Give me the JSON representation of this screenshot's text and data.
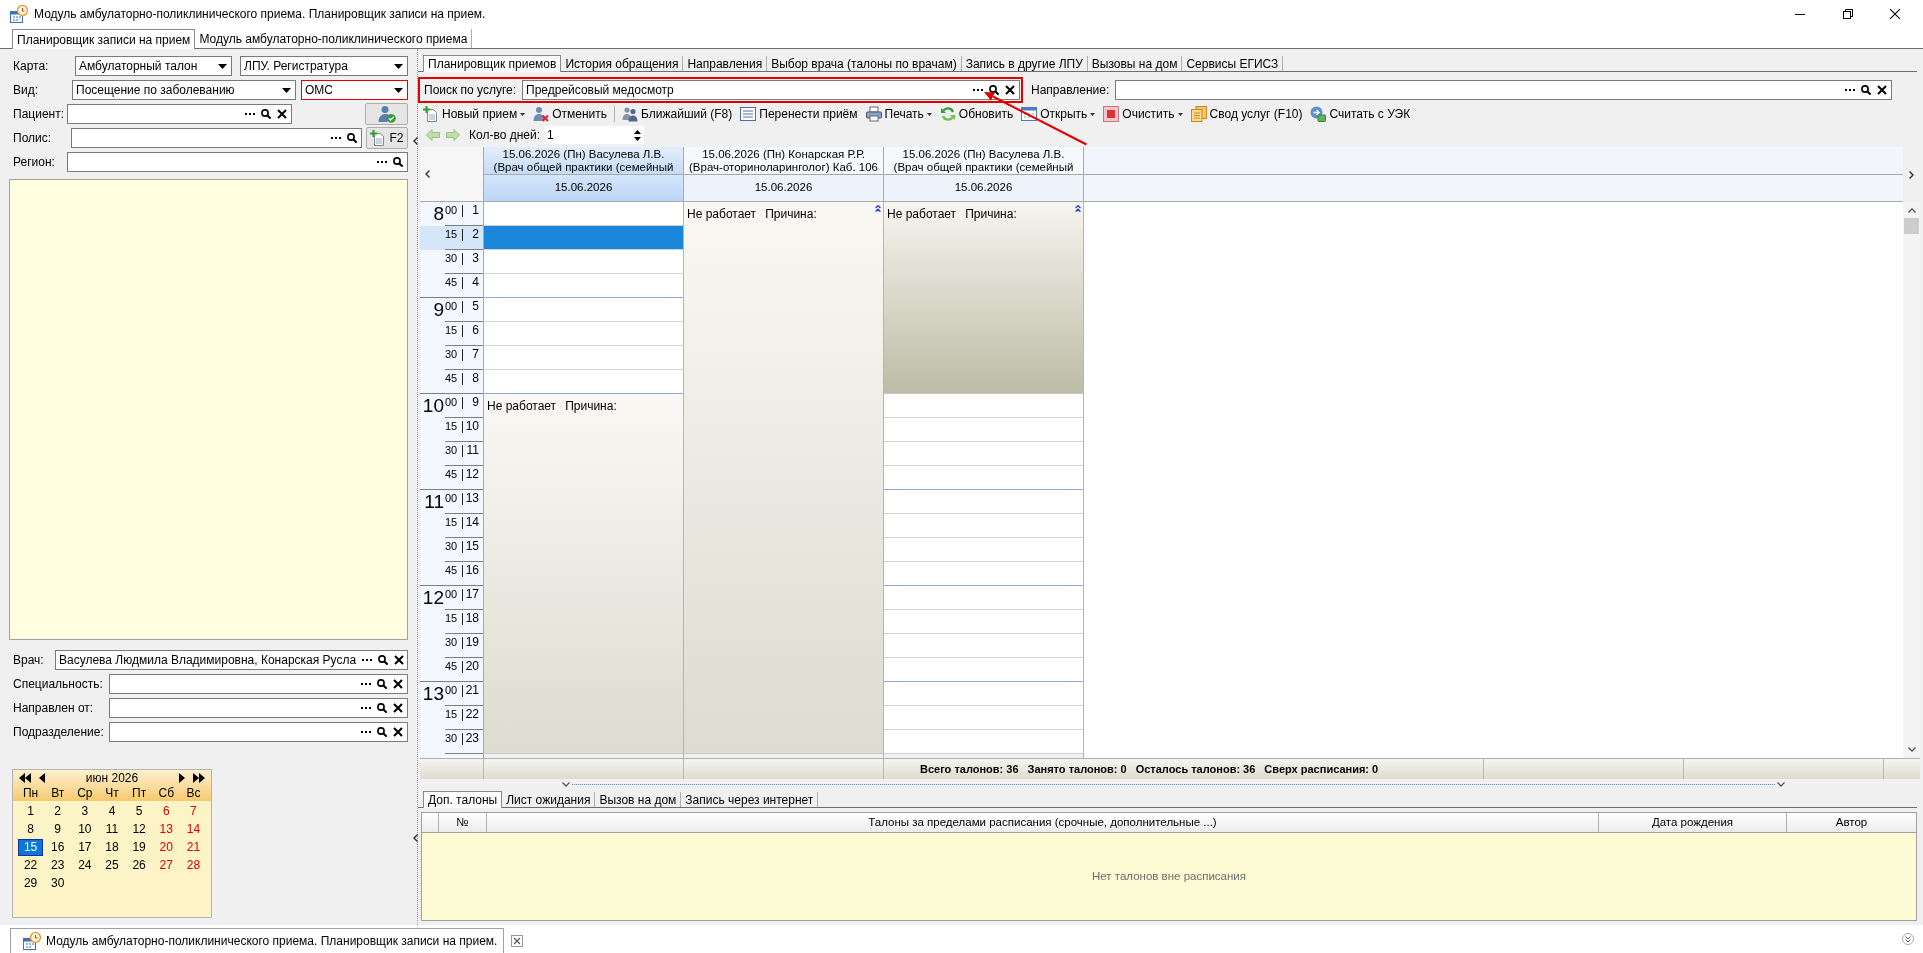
{
  "window": {
    "title": "Модуль амбулаторно-поликлинического приема. Планировщик записи на прием."
  },
  "main_tabs": [
    {
      "label": "Планировщик записи на прием",
      "selected": true
    },
    {
      "label": "Модуль амбулаторно-поликлинического приема",
      "selected": false
    }
  ],
  "left_panel": {
    "filters": [
      {
        "label": "Карта:",
        "controls": [
          {
            "kind": "dropdown",
            "value": "Амбулаторный талон"
          },
          {
            "kind": "dropdown",
            "value": "ЛПУ. Регистратура"
          }
        ]
      },
      {
        "label": "Вид:",
        "controls": [
          {
            "kind": "dropdown",
            "value": "Посещение по заболеванию"
          },
          {
            "kind": "dropdown",
            "value": "ОМС",
            "highlighted": true
          }
        ]
      },
      {
        "label": "Пациент:",
        "controls": [
          {
            "kind": "lookup",
            "actions": [
              {
                "kind": "browse"
              },
              {
                "kind": "search"
              },
              {
                "kind": "clear"
              }
            ]
          },
          {
            "kind": "patient_button"
          }
        ]
      },
      {
        "label": "Полис:",
        "controls": [
          {
            "kind": "lookup",
            "actions": [
              {
                "kind": "browse"
              },
              {
                "kind": "search"
              }
            ]
          },
          {
            "kind": "policy_button",
            "label": "F2"
          }
        ]
      },
      {
        "label": "Регион:",
        "controls": [
          {
            "kind": "lookup",
            "actions": [
              {
                "kind": "browse"
              },
              {
                "kind": "search"
              }
            ]
          }
        ]
      }
    ],
    "doctor_filters": [
      {
        "label": "Врач:",
        "value": "Васулева Людмила Владимировна, Конарская Русла",
        "actions": [
          {
            "kind": "browse"
          },
          {
            "kind": "search"
          },
          {
            "kind": "clear"
          }
        ]
      },
      {
        "label": "Специальность:",
        "actions": [
          {
            "kind": "browse"
          },
          {
            "kind": "search"
          },
          {
            "kind": "clear"
          }
        ]
      },
      {
        "label": "Направлен от:",
        "actions": [
          {
            "kind": "browse"
          },
          {
            "kind": "search"
          },
          {
            "kind": "clear"
          }
        ]
      },
      {
        "label": "Подразделение:",
        "actions": [
          {
            "kind": "browse"
          },
          {
            "kind": "search"
          },
          {
            "kind": "clear"
          }
        ]
      }
    ],
    "calendar": {
      "month": "июн 2026",
      "weekdays": [
        "Пн",
        "Вт",
        "Ср",
        "Чт",
        "Пт",
        "Сб",
        "Вс"
      ],
      "weeks": [
        [
          {
            "day": "1",
            "weekend": false,
            "selected": false
          },
          {
            "day": "2",
            "weekend": false,
            "selected": false
          },
          {
            "day": "3",
            "weekend": false,
            "selected": false
          },
          {
            "day": "4",
            "weekend": false,
            "selected": false
          },
          {
            "day": "5",
            "weekend": false,
            "selected": false
          },
          {
            "day": "6",
            "weekend": true,
            "selected": false
          },
          {
            "day": "7",
            "weekend": true,
            "selected": false
          }
        ],
        [
          {
            "day": "8",
            "weekend": false,
            "selected": false
          },
          {
            "day": "9",
            "weekend": false,
            "selected": false
          },
          {
            "day": "10",
            "weekend": false,
            "selected": false
          },
          {
            "day": "11",
            "weekend": false,
            "selected": false
          },
          {
            "day": "12",
            "weekend": false,
            "selected": false
          },
          {
            "day": "13",
            "weekend": true,
            "selected": false
          },
          {
            "day": "14",
            "weekend": true,
            "selected": false
          }
        ],
        [
          {
            "day": "15",
            "weekend": false,
            "selected": true
          },
          {
            "day": "16",
            "weekend": false,
            "selected": false
          },
          {
            "day": "17",
            "weekend": false,
            "selected": false
          },
          {
            "day": "18",
            "weekend": false,
            "selected": false
          },
          {
            "day": "19",
            "weekend": false,
            "selected": false
          },
          {
            "day": "20",
            "weekend": true,
            "selected": false
          },
          {
            "day": "21",
            "weekend": true,
            "selected": false
          }
        ],
        [
          {
            "day": "22",
            "weekend": false,
            "selected": false
          },
          {
            "day": "23",
            "weekend": false,
            "selected": false
          },
          {
            "day": "24",
            "weekend": false,
            "selected": false
          },
          {
            "day": "25",
            "weekend": false,
            "selected": false
          },
          {
            "day": "26",
            "weekend": false,
            "selected": false
          },
          {
            "day": "27",
            "weekend": true,
            "selected": false
          },
          {
            "day": "28",
            "weekend": true,
            "selected": false
          }
        ],
        [
          {
            "day": "29",
            "weekend": false,
            "selected": false
          },
          {
            "day": "30",
            "weekend": false,
            "selected": false
          }
        ]
      ]
    }
  },
  "right_panel": {
    "tabs": [
      {
        "label": "Планировщик приемов",
        "selected": true
      },
      {
        "label": "История обращения",
        "selected": false
      },
      {
        "label": "Направления",
        "selected": false
      },
      {
        "label": "Выбор врача (талоны по врачам)",
        "selected": false
      },
      {
        "label": "Запись в другие ЛПУ",
        "selected": false
      },
      {
        "label": "Вызовы на дом",
        "selected": false
      },
      {
        "label": "Сервисы ЕГИСЗ",
        "selected": false
      }
    ],
    "service_search": {
      "label": "Поиск по услуге:",
      "value": "Предрейсовый медосмотр",
      "highlighted": true,
      "callout_arrow": true,
      "actions": [
        {
          "kind": "browse"
        },
        {
          "kind": "search"
        },
        {
          "kind": "clear"
        }
      ]
    },
    "referral": {
      "label": "Направление:",
      "actions": [
        {
          "kind": "browse"
        },
        {
          "kind": "search"
        },
        {
          "kind": "clear"
        }
      ]
    },
    "toolbar": [
      {
        "kind": "new",
        "label": "Новый прием",
        "dropdown": true
      },
      {
        "kind": "cancel",
        "label": "Отменить"
      },
      {
        "kind": "separator"
      },
      {
        "kind": "nearest",
        "label": "Ближайший (F8)"
      },
      {
        "kind": "move",
        "label": "Перенести приём"
      },
      {
        "kind": "print",
        "label": "Печать",
        "dropdown": true
      },
      {
        "kind": "refresh",
        "label": "Обновить"
      },
      {
        "kind": "open",
        "label": "Открыть",
        "dropdown": true
      },
      {
        "kind": "clear",
        "label": "Очистить",
        "dropdown": true
      },
      {
        "kind": "services",
        "label": "Свод услуг (F10)"
      },
      {
        "kind": "card",
        "label": "Считать с УЭК"
      }
    ],
    "days": {
      "label": "Кол-во дней:",
      "value": "1"
    },
    "schedule": {
      "time_slots": [
        {
          "hour": "8",
          "minute": "00",
          "number": "1"
        },
        {
          "minute": "15",
          "number": "2"
        },
        {
          "minute": "30",
          "number": "3"
        },
        {
          "minute": "45",
          "number": "4"
        },
        {
          "hour": "9",
          "minute": "00",
          "number": "5"
        },
        {
          "minute": "15",
          "number": "6"
        },
        {
          "minute": "30",
          "number": "7"
        },
        {
          "minute": "45",
          "number": "8"
        },
        {
          "hour": "10",
          "minute": "00",
          "number": "9"
        },
        {
          "minute": "15",
          "number": "10"
        },
        {
          "minute": "30",
          "number": "11"
        },
        {
          "minute": "45",
          "number": "12"
        },
        {
          "hour": "11",
          "minute": "00",
          "number": "13"
        },
        {
          "minute": "15",
          "number": "14"
        },
        {
          "minute": "30",
          "number": "15"
        },
        {
          "minute": "45",
          "number": "16"
        },
        {
          "hour": "12",
          "minute": "00",
          "number": "17"
        },
        {
          "minute": "15",
          "number": "18"
        },
        {
          "minute": "30",
          "number": "19"
        },
        {
          "minute": "45",
          "number": "20"
        },
        {
          "hour": "13",
          "minute": "00",
          "number": "21"
        },
        {
          "minute": "15",
          "number": "22"
        },
        {
          "minute": "30",
          "number": "23"
        }
      ],
      "columns": [
        {
          "title": "15.06.2026 (Пн) Васулева Л.В.",
          "subtitle": "(Врач общей практики (семейный",
          "date": "15.06.2026",
          "selected": true,
          "off_status": "Не работает",
          "off_reason": "Причина:",
          "slots": [
            {
              "kind": "free",
              "selected": false
            },
            {
              "kind": "free",
              "selected": true
            },
            {
              "kind": "free",
              "selected": false
            },
            {
              "kind": "free",
              "selected": false
            },
            {
              "kind": "free",
              "selected": false
            },
            {
              "kind": "free",
              "selected": false
            },
            {
              "kind": "free",
              "selected": false
            },
            {
              "kind": "free",
              "selected": false
            },
            {
              "kind": "off"
            },
            {
              "kind": "off"
            },
            {
              "kind": "off"
            },
            {
              "kind": "off"
            },
            {
              "kind": "off"
            },
            {
              "kind": "off"
            },
            {
              "kind": "off"
            },
            {
              "kind": "off"
            },
            {
              "kind": "off"
            },
            {
              "kind": "off"
            },
            {
              "kind": "off"
            },
            {
              "kind": "off"
            },
            {
              "kind": "off"
            },
            {
              "kind": "off"
            },
            {
              "kind": "off"
            }
          ]
        },
        {
          "title": "15.06.2026 (Пн) Конарская Р.Р.",
          "subtitle": "(Врач-оториноларинголог) Каб. 106",
          "date": "15.06.2026",
          "selected": false,
          "off_status": "Не работает",
          "off_reason": "Причина:",
          "slots": [
            {
              "kind": "off"
            },
            {
              "kind": "off"
            },
            {
              "kind": "off"
            },
            {
              "kind": "off"
            },
            {
              "kind": "off"
            },
            {
              "kind": "off"
            },
            {
              "kind": "off"
            },
            {
              "kind": "off"
            },
            {
              "kind": "off"
            },
            {
              "kind": "off"
            },
            {
              "kind": "off"
            },
            {
              "kind": "off"
            },
            {
              "kind": "off"
            },
            {
              "kind": "off"
            },
            {
              "kind": "off"
            },
            {
              "kind": "off"
            },
            {
              "kind": "off"
            },
            {
              "kind": "off"
            },
            {
              "kind": "off"
            },
            {
              "kind": "off"
            },
            {
              "kind": "off"
            },
            {
              "kind": "off"
            },
            {
              "kind": "off"
            }
          ]
        },
        {
          "title": "15.06.2026 (Пн) Васулева Л.В.",
          "subtitle": "(Врач общей практики (семейный",
          "date": "15.06.2026",
          "selected": false,
          "off_status": "Не работает",
          "off_reason": "Причина:",
          "slots": [
            {
              "kind": "off"
            },
            {
              "kind": "off"
            },
            {
              "kind": "off"
            },
            {
              "kind": "off"
            },
            {
              "kind": "off"
            },
            {
              "kind": "off"
            },
            {
              "kind": "off"
            },
            {
              "kind": "off"
            },
            {
              "kind": "free",
              "selected": false
            },
            {
              "kind": "free",
              "selected": false
            },
            {
              "kind": "free",
              "selected": false
            },
            {
              "kind": "free",
              "selected": false
            },
            {
              "kind": "free",
              "selected": false
            },
            {
              "kind": "free",
              "selected": false
            },
            {
              "kind": "free",
              "selected": false
            },
            {
              "kind": "free",
              "selected": false
            },
            {
              "kind": "free",
              "selected": false
            },
            {
              "kind": "free",
              "selected": false
            },
            {
              "kind": "free",
              "selected": false
            },
            {
              "kind": "free",
              "selected": false
            },
            {
              "kind": "free",
              "selected": false
            },
            {
              "kind": "free",
              "selected": false
            },
            {
              "kind": "free",
              "selected": false
            }
          ]
        }
      ],
      "summary": [
        "Всего талонов: 36",
        "Занято талонов: 0",
        "Осталось талонов: 36",
        "Сверх расписания: 0"
      ]
    },
    "bottom_tabs": [
      {
        "label": "Доп. талоны",
        "selected": true
      },
      {
        "label": "Лист ожидания",
        "selected": false
      },
      {
        "label": "Вызов на дом",
        "selected": false
      },
      {
        "label": "Запись через интернет",
        "selected": false
      }
    ],
    "extra_table": {
      "columns": [
        "№",
        "Талоны за пределами расписания (срочные, дополнительные ...)",
        "Дата рождения",
        "Автор"
      ],
      "empty_text": "Нет талонов вне расписания"
    }
  },
  "taskbar": {
    "tabs": [
      {
        "label": "Модуль амбулаторно-поликлинического приема. Планировщик записи на прием."
      }
    ]
  }
}
